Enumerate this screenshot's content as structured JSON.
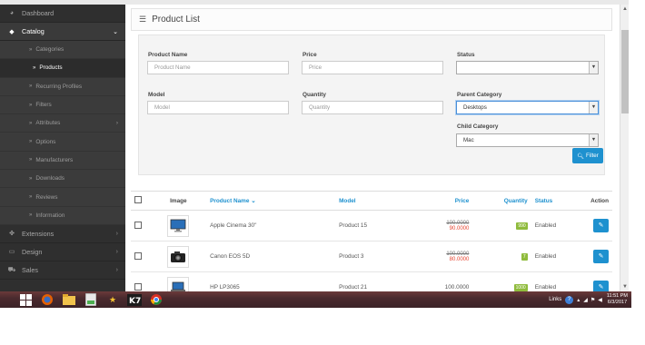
{
  "sidebar": {
    "items_top": [
      {
        "label": "Dashboard",
        "icon": "dashboard-icon"
      },
      {
        "label": "Catalog",
        "icon": "tag-icon"
      }
    ],
    "catalog_sub": [
      {
        "label": "Categories"
      },
      {
        "label": "Products"
      },
      {
        "label": "Recurring Profiles"
      },
      {
        "label": "Filters"
      },
      {
        "label": "Attributes"
      },
      {
        "label": "Options"
      },
      {
        "label": "Manufacturers"
      },
      {
        "label": "Downloads"
      },
      {
        "label": "Reviews"
      },
      {
        "label": "Information"
      }
    ],
    "items_bottom": [
      {
        "label": "Extensions",
        "icon": "puzzle-icon"
      },
      {
        "label": "Design",
        "icon": "monitor-icon"
      },
      {
        "label": "Sales",
        "icon": "cart-icon"
      }
    ]
  },
  "panel": {
    "title": "Product List",
    "icon": "list-icon"
  },
  "filter": {
    "product_name_label": "Product Name",
    "product_name_placeholder": "Product Name",
    "price_label": "Price",
    "price_placeholder": "Price",
    "status_label": "Status",
    "status_value": "",
    "model_label": "Model",
    "model_placeholder": "Model",
    "quantity_label": "Quantity",
    "quantity_placeholder": "Quantity",
    "parent_category_label": "Parent Category",
    "parent_category_value": "Desktops",
    "child_category_label": "Child Category",
    "child_category_value": "Mac",
    "filter_button": "Filter"
  },
  "table": {
    "headers": {
      "image": "Image",
      "product_name": "Product Name",
      "model": "Model",
      "price": "Price",
      "quantity": "Quantity",
      "status": "Status",
      "action": "Action"
    },
    "rows": [
      {
        "name": "Apple Cinema 30\"",
        "model": "Product 15",
        "price_old": "100.0000",
        "price_new": "90.0000",
        "quantity": "990",
        "status": "Enabled",
        "thumb": "monitor"
      },
      {
        "name": "Canon EOS 5D",
        "model": "Product 3",
        "price_old": "100.0000",
        "price_new": "80.0000",
        "quantity": "7",
        "status": "Enabled",
        "thumb": "camera"
      },
      {
        "name": "HP LP3065",
        "model": "Product 21",
        "price_old": "",
        "price_new": "",
        "price": "100.0000",
        "quantity": "1000",
        "status": "Enabled",
        "thumb": "laptop"
      }
    ]
  },
  "taskbar": {
    "tray_links": "Links",
    "clock_time": "11:51 PM",
    "clock_date": "6/3/2017"
  },
  "colors": {
    "accent": "#1e91cf",
    "sidebar": "#2f2f2f",
    "sale_price": "#e5412d",
    "qty_badge": "#8fbb3c"
  }
}
